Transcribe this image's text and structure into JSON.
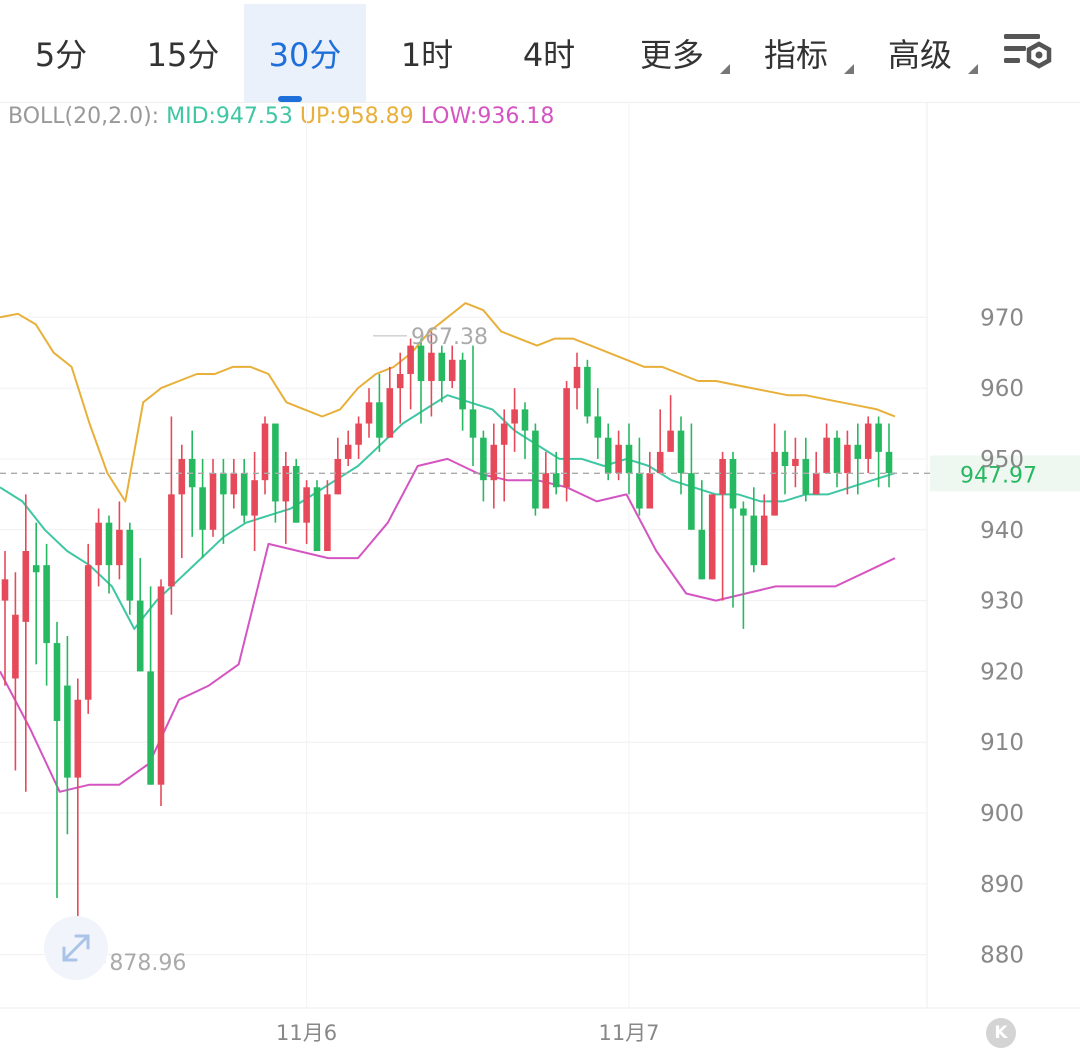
{
  "tabs": [
    {
      "label": "5分",
      "active": false,
      "dropdown": false
    },
    {
      "label": "15分",
      "active": false,
      "dropdown": false
    },
    {
      "label": "30分",
      "active": true,
      "dropdown": false
    },
    {
      "label": "1时",
      "active": false,
      "dropdown": false
    },
    {
      "label": "4时",
      "active": false,
      "dropdown": false
    },
    {
      "label": "更多",
      "active": false,
      "dropdown": true
    },
    {
      "label": "指标",
      "active": false,
      "dropdown": true
    },
    {
      "label": "高级",
      "active": false,
      "dropdown": true
    }
  ],
  "icons": {
    "settings": "chart-settings-icon",
    "expand": "expand-arrows-icon",
    "scroll_latest": "k-icon"
  },
  "boll": {
    "label": "BOLL(20,2.0):",
    "mid": "MID:947.53",
    "up": "UP:958.89",
    "low": "LOW:936.18"
  },
  "current_price": "947.97",
  "high_marker": "967.38",
  "low_marker": "878.96",
  "scroll_latest_label": "K",
  "colors": {
    "up": "#e64a5a",
    "down": "#27b862",
    "mid": "#3fc6a3",
    "upper": "#e8b03a",
    "lower": "#d455c1",
    "active_tab": "#1e6fd9",
    "price_line": "#aaaaaa",
    "price_label": "#27b862"
  },
  "chart_data": {
    "type": "candlestick",
    "indicator": "BOLL(20,2.0)",
    "ylim": [
      876,
      986
    ],
    "yticks": [
      970,
      960,
      950,
      940,
      930,
      920,
      910,
      900,
      890,
      880
    ],
    "xticks": [
      {
        "label": "11月6",
        "index": 29
      },
      {
        "label": "11月7",
        "index": 60
      }
    ],
    "candles": [
      [
        930,
        933,
        918,
        937
      ],
      [
        919,
        928,
        906,
        934
      ],
      [
        927,
        937,
        903,
        945
      ],
      [
        935,
        934,
        921,
        941
      ],
      [
        935,
        924,
        918,
        938
      ],
      [
        924,
        913,
        888,
        927
      ],
      [
        918,
        905,
        897,
        925
      ],
      [
        905,
        916,
        879,
        919
      ],
      [
        916,
        935,
        914,
        938
      ],
      [
        935,
        941,
        932,
        943
      ],
      [
        941,
        935,
        931,
        942
      ],
      [
        935,
        940,
        933,
        944
      ],
      [
        940,
        930,
        928,
        941
      ],
      [
        930,
        920,
        924,
        936
      ],
      [
        920,
        904,
        905,
        932
      ],
      [
        904,
        932,
        901,
        933
      ],
      [
        932,
        945,
        928,
        956
      ],
      [
        945,
        950,
        936,
        952
      ],
      [
        950,
        946,
        939,
        954
      ],
      [
        946,
        940,
        936,
        950
      ],
      [
        940,
        948,
        939,
        950
      ],
      [
        948,
        945,
        938,
        950
      ],
      [
        945,
        948,
        943,
        950
      ],
      [
        948,
        942,
        941,
        950
      ],
      [
        942,
        947,
        937,
        951
      ],
      [
        947,
        955,
        945,
        956
      ],
      [
        955,
        944,
        941,
        955
      ],
      [
        944,
        949,
        938,
        951
      ],
      [
        949,
        941,
        941,
        950
      ],
      [
        941,
        946,
        938,
        947
      ],
      [
        946,
        937,
        937,
        947
      ],
      [
        937,
        945,
        943,
        947
      ],
      [
        945,
        950,
        946,
        953
      ],
      [
        950,
        952,
        949,
        954
      ],
      [
        952,
        955,
        950,
        956
      ],
      [
        955,
        958,
        953,
        960
      ],
      [
        958,
        953,
        951,
        962
      ],
      [
        953,
        960,
        954,
        963
      ],
      [
        960,
        962,
        955,
        965
      ],
      [
        962,
        966,
        957,
        967
      ],
      [
        966,
        961,
        955,
        967
      ],
      [
        961,
        965,
        956,
        968
      ],
      [
        965,
        961,
        958,
        966
      ],
      [
        961,
        964,
        960,
        966
      ],
      [
        964,
        957,
        954,
        965
      ],
      [
        957,
        953,
        949,
        966
      ],
      [
        953,
        947,
        944,
        954
      ],
      [
        947,
        952,
        943,
        955
      ],
      [
        952,
        955,
        944,
        957
      ],
      [
        955,
        957,
        951,
        960
      ],
      [
        957,
        954,
        950,
        958
      ],
      [
        954,
        943,
        942,
        955
      ],
      [
        943,
        948,
        946,
        951
      ],
      [
        948,
        946,
        945,
        951
      ],
      [
        946,
        960,
        944,
        961
      ],
      [
        960,
        963,
        957,
        965
      ],
      [
        963,
        956,
        955,
        964
      ],
      [
        956,
        953,
        950,
        960
      ],
      [
        953,
        948,
        947,
        955
      ],
      [
        948,
        952,
        947,
        954
      ],
      [
        952,
        948,
        945,
        955
      ],
      [
        948,
        943,
        942,
        953
      ],
      [
        943,
        948,
        944,
        951
      ],
      [
        948,
        951,
        949,
        957
      ],
      [
        951,
        954,
        952,
        959
      ],
      [
        954,
        948,
        945,
        956
      ],
      [
        948,
        940,
        940,
        955
      ],
      [
        940,
        933,
        935,
        947
      ],
      [
        933,
        945,
        937,
        943
      ],
      [
        945,
        950,
        930,
        951
      ],
      [
        950,
        943,
        929,
        951
      ],
      [
        943,
        942,
        926,
        944
      ],
      [
        942,
        935,
        934,
        946
      ],
      [
        935,
        942,
        938,
        945
      ],
      [
        942,
        951,
        944,
        955
      ],
      [
        951,
        949,
        945,
        954
      ],
      [
        949,
        950,
        946,
        953
      ],
      [
        950,
        945,
        944,
        953
      ],
      [
        945,
        948,
        946,
        951
      ],
      [
        948,
        953,
        950,
        955
      ],
      [
        953,
        948,
        946,
        954
      ],
      [
        948,
        952,
        945,
        954
      ],
      [
        952,
        950,
        945,
        955
      ],
      [
        950,
        955,
        948,
        956
      ],
      [
        955,
        951,
        946,
        956
      ],
      [
        951,
        948,
        946,
        955
      ]
    ],
    "bands": {
      "upper": [
        970,
        970.5,
        969,
        965,
        963,
        955,
        948,
        944,
        958,
        960,
        961,
        962,
        962,
        963,
        963,
        962,
        958,
        957,
        956,
        957,
        960,
        962,
        963,
        965,
        968,
        970,
        972,
        971,
        968,
        967,
        966,
        967,
        967,
        966,
        965,
        964,
        963,
        963,
        962,
        961,
        961,
        960.5,
        960,
        959.5,
        959,
        959,
        958.5,
        958,
        957.5,
        957,
        956
      ],
      "mid": [
        946,
        944,
        940,
        937,
        935,
        932,
        926,
        930,
        933,
        936,
        939,
        941,
        942,
        943,
        945,
        947,
        949,
        952,
        955,
        957,
        959,
        958,
        957,
        954,
        952,
        950,
        950,
        949,
        950,
        949,
        947,
        946,
        945,
        945,
        944,
        944,
        945,
        945,
        946,
        947,
        948
      ],
      "lower": [
        920,
        912,
        903,
        904,
        904,
        907,
        916,
        918,
        921,
        938,
        937,
        936,
        936,
        941,
        949,
        950,
        948,
        947,
        947,
        946,
        944,
        945,
        937,
        931,
        930,
        931,
        932,
        932,
        932,
        934,
        936
      ]
    }
  }
}
